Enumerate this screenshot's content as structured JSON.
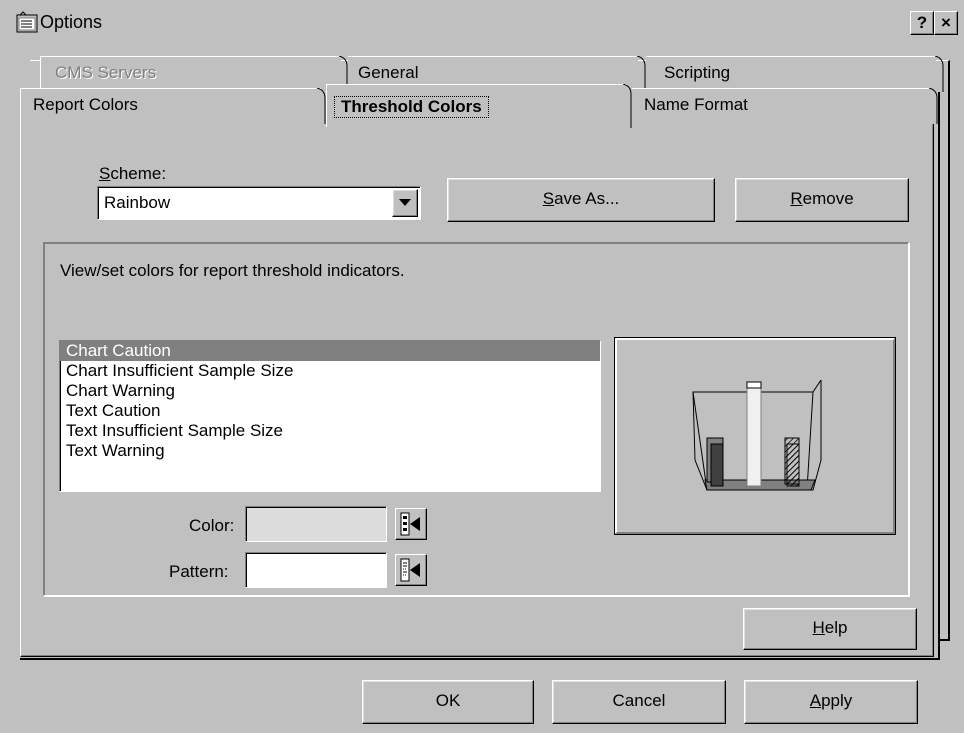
{
  "window": {
    "title": "Options",
    "help_btn": "?",
    "close_btn": "×"
  },
  "tabs": {
    "row1": [
      "CMS Servers",
      "General",
      "Scripting"
    ],
    "row2": [
      "Report Colors",
      "Threshold Colors",
      "Name Format"
    ],
    "active": "Threshold Colors",
    "disabled": [
      "CMS Servers"
    ]
  },
  "scheme": {
    "label": "Scheme:",
    "label_mnemonic": "S",
    "label_rest": "cheme:",
    "value": "Rainbow",
    "save_as_mnemonic": "S",
    "save_as_rest": "ave As...",
    "remove_mnemonic": "R",
    "remove_rest": "emove"
  },
  "group": {
    "description": "View/set colors for report threshold indicators.",
    "items": [
      "Chart Caution",
      "Chart Insufficient Sample Size",
      "Chart Warning",
      "Text Caution",
      "Text Insufficient Sample Size",
      "Text Warning"
    ],
    "selected_item": "Chart Caution",
    "color_label": "Color:",
    "pattern_label": "Pattern:",
    "color_value": "",
    "pattern_value": ""
  },
  "buttons": {
    "help_mnemonic": "H",
    "help_rest": "elp",
    "ok": "OK",
    "cancel": "Cancel",
    "apply_mnemonic": "A",
    "apply_rest": "pply"
  },
  "colors": {
    "face": "#c0c0c0",
    "highlight": "#808080",
    "window": "#ffffff"
  },
  "icons": {
    "title": "options-app-icon",
    "dropdown": "down-arrow-icon",
    "color_picker": "color-picker-icon",
    "pattern_picker": "pattern-picker-icon",
    "preview": "threshold-chart-preview-icon"
  }
}
